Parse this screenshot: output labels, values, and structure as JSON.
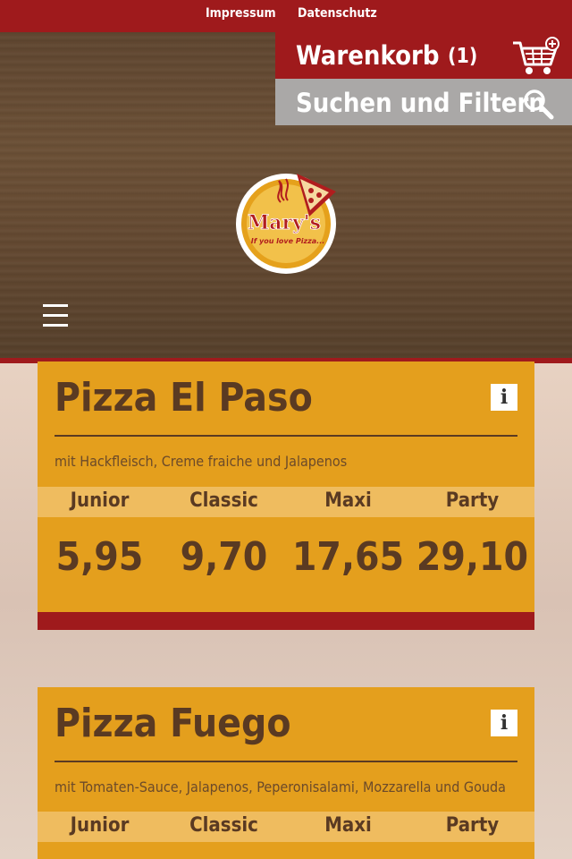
{
  "top_links": [
    "Impressum",
    "Datenschutz"
  ],
  "cart": {
    "label": "Warenkorb",
    "count": "(1)"
  },
  "search": {
    "label": "Suchen und Filtern"
  },
  "logo": {
    "name": "Mary's",
    "tagline": "If you love Pizza..."
  },
  "icons": {
    "cart": "cart-add-icon",
    "search": "magnifier-icon",
    "menu": "hamburger-icon",
    "info": "info-icon"
  },
  "colors": {
    "brand_red": "#9f1a1c",
    "card_orange": "#e49f1d",
    "size_row": "#efbc5f",
    "text_brown": "#5a3a22",
    "search_gray": "#aaa8a7"
  },
  "products": [
    {
      "name": "Pizza El Paso",
      "info": "i",
      "description": "mit Hackfleisch, Creme fraiche und Jalapenos",
      "sizes": [
        "Junior",
        "Classic",
        "Maxi",
        "Party"
      ],
      "prices": [
        "5,95",
        "9,70",
        "17,65",
        "29,10"
      ]
    },
    {
      "name": "Pizza Fuego",
      "info": "i",
      "description": "mit Tomaten-Sauce, Jalapenos, Peperonisalami, Mozzarella und Gouda",
      "sizes": [
        "Junior",
        "Classic",
        "Maxi",
        "Party"
      ]
    }
  ]
}
